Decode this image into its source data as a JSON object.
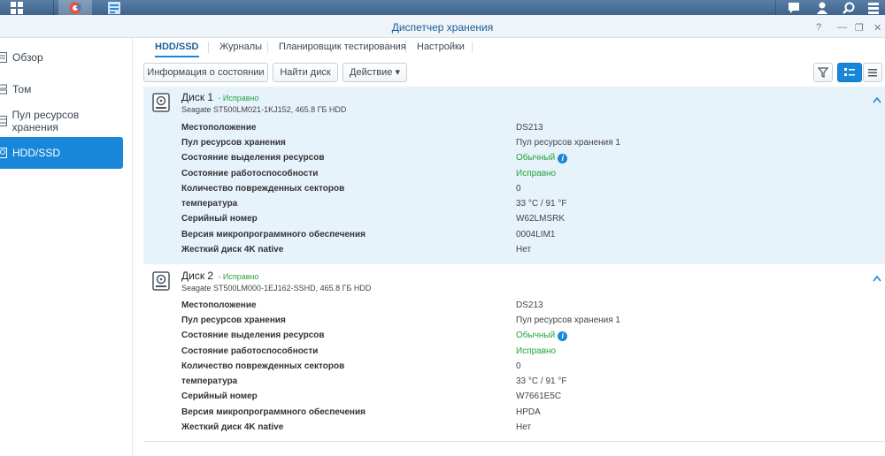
{
  "window": {
    "title": "Диспетчер хранения"
  },
  "sidebar": {
    "items": [
      {
        "label": "Обзор",
        "icon": "overview-icon"
      },
      {
        "label": "Том",
        "icon": "volume-icon"
      },
      {
        "label": "Пул ресурсов хранения",
        "icon": "storage-pool-icon"
      },
      {
        "label": "HDD/SSD",
        "icon": "hdd-icon",
        "active": true
      }
    ]
  },
  "tabs": [
    {
      "label": "HDD/SSD",
      "active": true
    },
    {
      "label": "Журналы"
    },
    {
      "label": "Планировщик тестирования"
    },
    {
      "label": "Настройки"
    }
  ],
  "toolbar": {
    "health_info": "Информация о состоянии",
    "find_disk": "Найти диск",
    "action": "Действие ▾"
  },
  "disks": [
    {
      "name": "Диск 1",
      "status": "- Исправно",
      "model": "Seagate ST500LM021-1KJ152, 465.8 ГБ HDD",
      "rows": [
        {
          "key": "Местоположение",
          "value": "DS213"
        },
        {
          "key": "Пул ресурсов хранения",
          "value": "Пул ресурсов хранения 1"
        },
        {
          "key": "Состояние выделения ресурсов",
          "value": "Обычный"
        },
        {
          "key": "Состояние работоспособности",
          "value": "Исправно"
        },
        {
          "key": "Количество поврежденных секторов",
          "value": "0"
        },
        {
          "key": "температура",
          "value": "33 °C / 91 °F"
        },
        {
          "key": "Серийный номер",
          "value": "W62LMSRK"
        },
        {
          "key": "Версия микропрограммного обеспечения",
          "value": "0004LIM1"
        },
        {
          "key": "Жесткий диск 4K native",
          "value": "Нет"
        }
      ]
    },
    {
      "name": "Диск 2",
      "status": "- Исправно",
      "model": "Seagate ST500LM000-1EJ162-SSHD, 465.8 ГБ HDD",
      "rows": [
        {
          "key": "Местоположение",
          "value": "DS213"
        },
        {
          "key": "Пул ресурсов хранения",
          "value": "Пул ресурсов хранения 1"
        },
        {
          "key": "Состояние выделения ресурсов",
          "value": "Обычный"
        },
        {
          "key": "Состояние работоспособности",
          "value": "Исправно"
        },
        {
          "key": "Количество поврежденных секторов",
          "value": "0"
        },
        {
          "key": "температура",
          "value": "33 °C / 91 °F"
        },
        {
          "key": "Серийный номер",
          "value": "W7661E5C"
        },
        {
          "key": "Версия микропрограммного обеспечения",
          "value": "HPDA"
        },
        {
          "key": "Жесткий диск 4K native",
          "value": "Нет"
        }
      ]
    }
  ],
  "colors": {
    "accent": "#1987d9",
    "healthy": "#24a33b",
    "selected_panel": "#e7f3fb"
  }
}
